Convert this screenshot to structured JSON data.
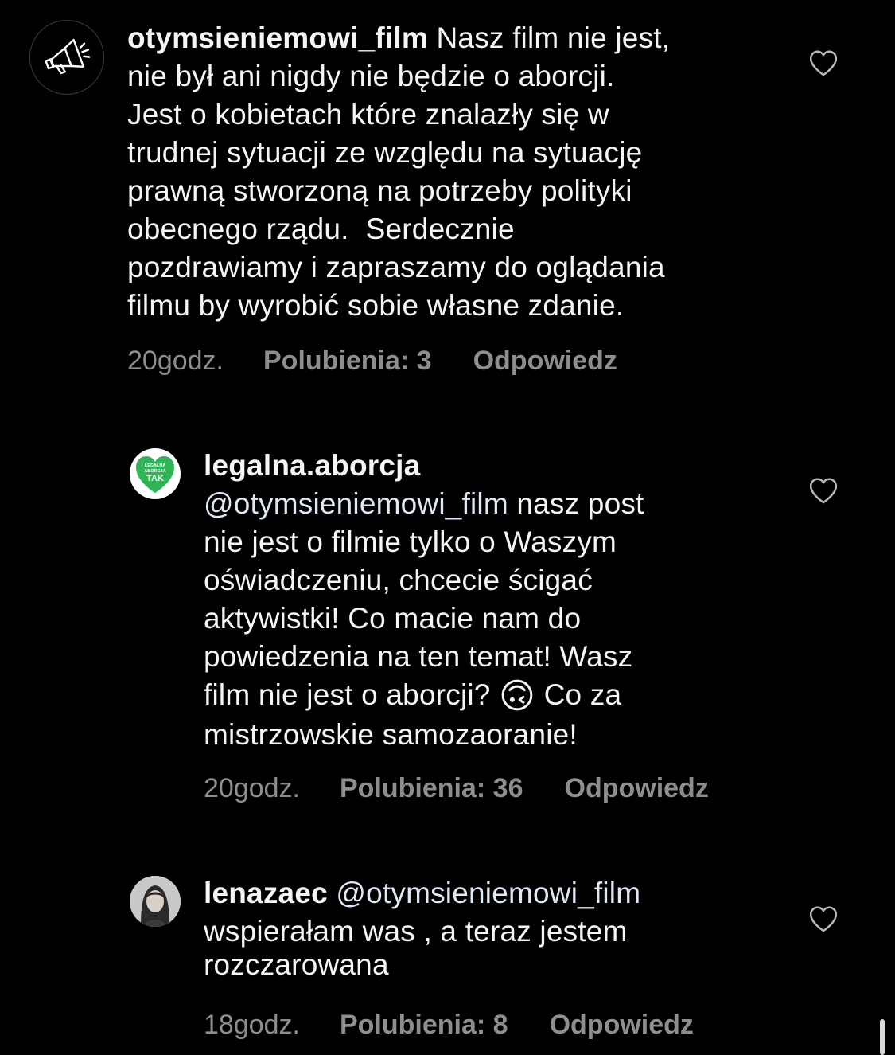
{
  "comments": [
    {
      "username": "otymsieniemowi_film",
      "lines": [
        "Nasz film nie jest,",
        "nie był ani nigdy nie będzie o aborcji.",
        "Jest o kobietach które znalazły się w",
        "trudnej sytuacji ze względu na sytuację",
        "prawną stworzoną na potrzeby polityki",
        "obecnego rządu.  Serdecznie",
        "pozdrawiamy i zapraszamy do oglądania",
        "filmu by wyrobić sobie własne zdanie."
      ],
      "time": "20godz.",
      "likes": "Polubienia: 3",
      "reply": "Odpowiedz",
      "avatar_icon": "megaphone-icon"
    },
    {
      "username": "legalna.aborcja",
      "mention": "@otymsieniemowi_film",
      "lines": [
        "nasz post",
        "nie jest o filmie tylko o Waszym",
        "oświadczeniu, chcecie ścigać",
        "aktywistki! Co macie nam do",
        "powiedzenia na ten temat! Wasz",
        "film nie jest o aborcji? ",
        "Co za",
        "mistrzowskie samozaoranie!"
      ],
      "emoji": "🙃",
      "time": "20godz.",
      "likes": "Polubienia: 36",
      "reply": "Odpowiedz",
      "avatar_logo": {
        "line1": "LEGALNA",
        "line2": "ABORCJA",
        "line3": "TAK",
        "color": "#2fb457"
      }
    },
    {
      "username": "lenazaec",
      "mention": "@otymsieniemowi_film",
      "lines": [
        "wspierałam was , a teraz jestem",
        "rozczarowana"
      ],
      "time": "18godz.",
      "likes": "Polubienia: 8",
      "reply": "Odpowiedz",
      "avatar_icon": "profile-photo"
    }
  ],
  "colors": {
    "background": "#000000",
    "text": "#f5f5f5",
    "meta": "#8e8e8e"
  }
}
